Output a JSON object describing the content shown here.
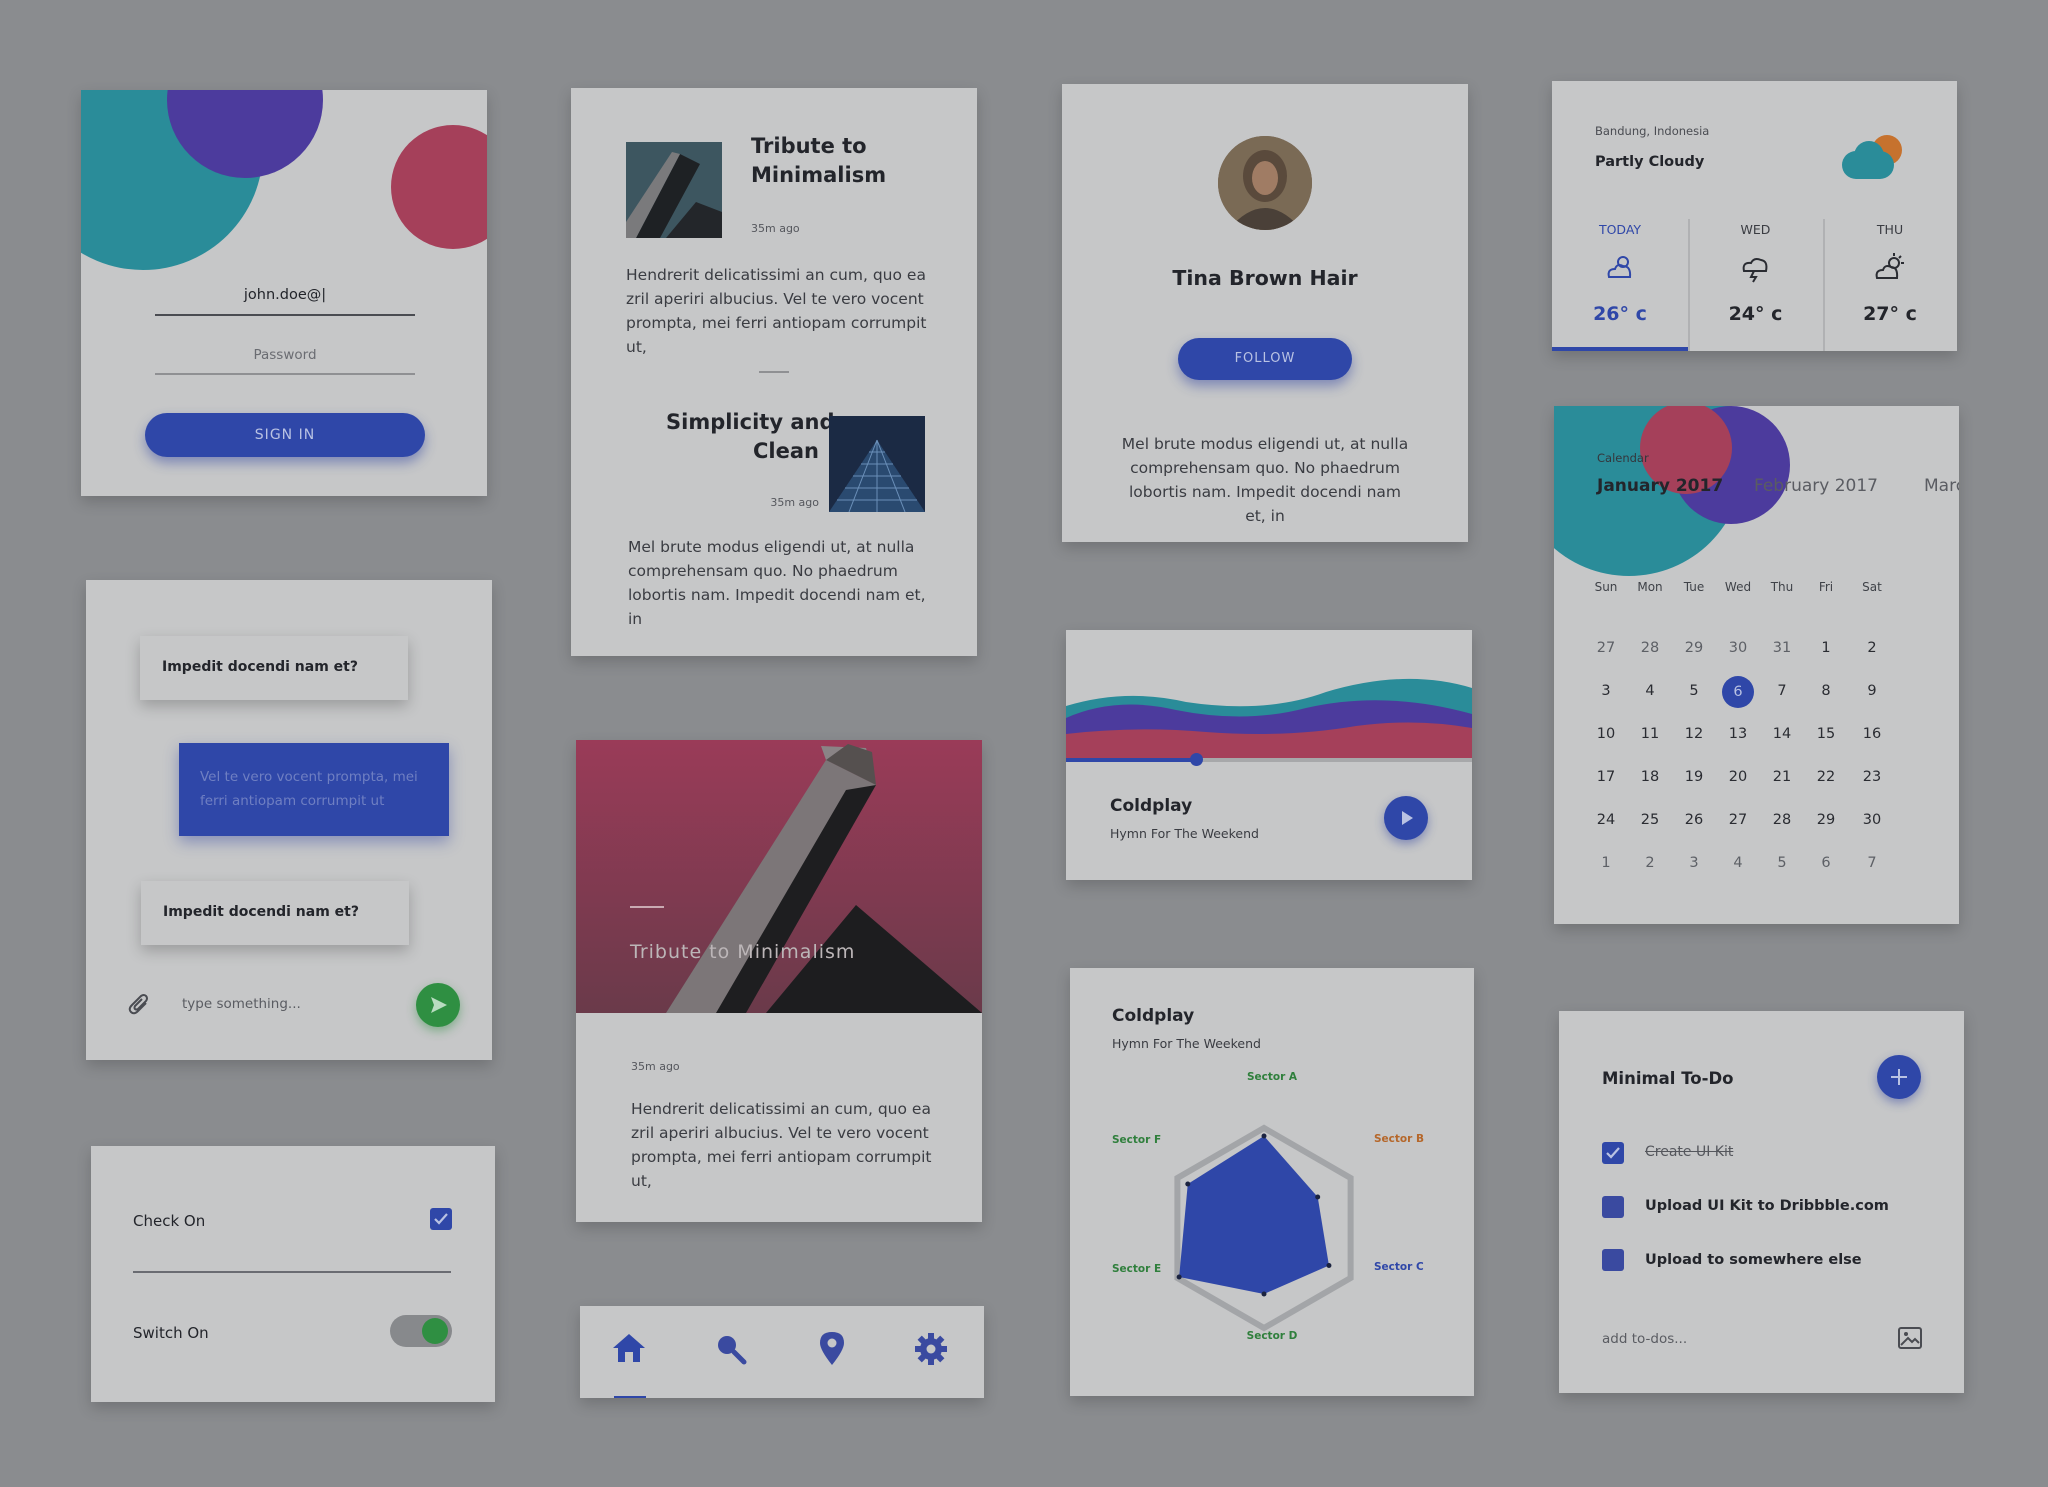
{
  "login": {
    "email_value": "john.doe@|",
    "password_placeholder": "Password",
    "signin_label": "SIGN IN"
  },
  "blog": {
    "post1_title_line1": "Tribute to",
    "post1_title_line2": "Minimalism",
    "post1_time": "35m ago",
    "post1_body": "Hendrerit delicatissimi an cum, quo ea zril aperiri albucius. Vel te vero vocent prompta, mei ferri antiopam corrumpit ut,",
    "post2_title_line1": "Simplicity and",
    "post2_title_line2": "Clean",
    "post2_time": "35m ago",
    "post2_body": "Mel brute modus eligendi ut, at nulla comprehensam quo. No phaedrum lobortis nam. Impedit docendi nam et, in"
  },
  "profile": {
    "name": "Tina Brown Hair",
    "follow_label": "FOLLOW",
    "bio": "Mel brute modus eligendi ut, at nulla comprehensam quo. No phaedrum lobortis nam. Impedit docendi nam et, in"
  },
  "weather": {
    "location": "Bandung, Indonesia",
    "condition": "Partly Cloudy",
    "days": [
      {
        "label": "TODAY",
        "temp": "26° c",
        "icon": "partly-cloudy-icon"
      },
      {
        "label": "WED",
        "temp": "24° c",
        "icon": "storm-icon"
      },
      {
        "label": "THU",
        "temp": "27° c",
        "icon": "sun-cloud-icon"
      }
    ]
  },
  "chat": {
    "msg1": "Impedit docendi nam et?",
    "msg2": "Vel te vero vocent prompta, mei ferri antiopam corrumpit ut",
    "msg3": "Impedit docendi nam et?",
    "input_placeholder": "type something..."
  },
  "feature": {
    "title": "Tribute to Minimalism",
    "time": "35m ago",
    "body": "Hendrerit delicatissimi an cum, quo ea zril aperiri albucius. Vel te vero vocent prompta, mei ferri antiopam corrumpit ut,"
  },
  "player": {
    "artist": "Coldplay",
    "song": "Hymn For The Weekend",
    "progress": 0.33
  },
  "calendar": {
    "label": "Calendar",
    "months": [
      "January 2017",
      "February 2017",
      "Marc"
    ],
    "weekdays": [
      "Sun",
      "Mon",
      "Tue",
      "Wed",
      "Thu",
      "Fri",
      "Sat"
    ],
    "weeks": [
      [
        "27",
        "28",
        "29",
        "30",
        "31",
        "1",
        "2"
      ],
      [
        "3",
        "4",
        "5",
        "6",
        "7",
        "8",
        "9"
      ],
      [
        "10",
        "11",
        "12",
        "13",
        "14",
        "15",
        "16"
      ],
      [
        "17",
        "18",
        "19",
        "20",
        "21",
        "22",
        "23"
      ],
      [
        "24",
        "25",
        "26",
        "27",
        "28",
        "29",
        "30"
      ],
      [
        "1",
        "2",
        "3",
        "4",
        "5",
        "6",
        "7"
      ]
    ],
    "selected": "6"
  },
  "settings": {
    "check_label": "Check On",
    "switch_label": "Switch On"
  },
  "radar": {
    "artist": "Coldplay",
    "song": "Hymn For The Weekend",
    "sectors": [
      "Sector A",
      "Sector B",
      "Sector C",
      "Sector D",
      "Sector E",
      "Sector F"
    ],
    "values": [
      0.92,
      0.62,
      0.75,
      0.66,
      0.98,
      0.88
    ]
  },
  "todo": {
    "title": "Minimal To-Do",
    "items": [
      {
        "label": "Create UI Kit",
        "done": true
      },
      {
        "label": "Upload UI Kit to Dribbble.com",
        "done": false
      },
      {
        "label": "Upload to somewhere else",
        "done": false
      }
    ],
    "add_placeholder": "add to-dos..."
  },
  "colors": {
    "blue": "#2f47a8",
    "teal": "#2a8c99",
    "pink": "#a5405a",
    "purple": "#4c3b9d",
    "green": "#2f8f42"
  }
}
